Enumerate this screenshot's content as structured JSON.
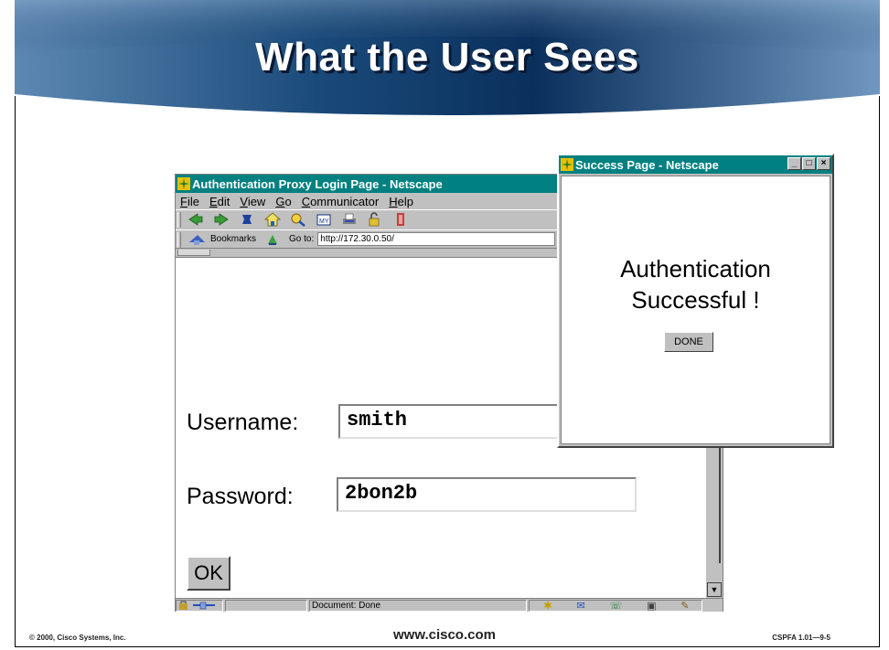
{
  "slide": {
    "title": "What the User Sees",
    "footer_left": "© 2000, Cisco Systems, Inc.",
    "footer_center": "www.cisco.com",
    "footer_right": "CSPFA 1.01—9-5"
  },
  "main_window": {
    "title": "Authentication Proxy Login Page - Netscape",
    "menu": [
      "File",
      "Edit",
      "View",
      "Go",
      "Communicator",
      "Help"
    ],
    "toolbar_icons": [
      "back-icon",
      "forward-icon",
      "reload-icon",
      "home-icon",
      "search-icon",
      "my-netscape-icon",
      "print-icon",
      "security-icon",
      "stop-icon"
    ],
    "bookmarks_label": "Bookmarks",
    "goto_label": "Go to:",
    "url": "http://172.30.0.50/",
    "username_label": "Username:",
    "username_value": "smith",
    "password_label": "Password:",
    "password_value": "2bon2b",
    "ok_label": "OK",
    "status_text": "Document: Done"
  },
  "popup_window": {
    "title": "Success Page - Netscape",
    "message_line1": "Authentication",
    "message_line2": "Successful !",
    "done_label": "DONE"
  },
  "colors": {
    "titlebar": "#008080",
    "banner_dark": "#0b2f5a",
    "banner_light": "#7fa6c9"
  }
}
